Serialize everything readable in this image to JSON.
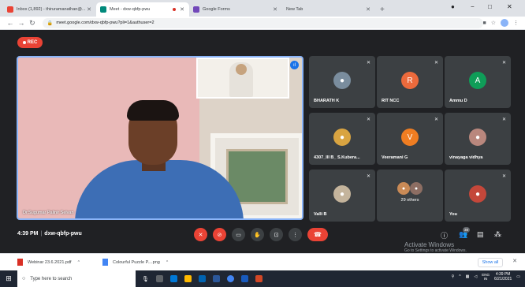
{
  "browser": {
    "tabs": [
      {
        "title": "Inbox (1,892) - thiruramanathan@...",
        "color": "#ea4335"
      },
      {
        "title": "Meet - dxw-qbfp-pwu",
        "color": "#00897b"
      },
      {
        "title": "Google Forms",
        "color": "#7248b9"
      },
      {
        "title": "New Tab",
        "color": "#dee1e6"
      }
    ],
    "url": "meet.google.com/dxw-qbfp-pwu?pli=1&authuser=2"
  },
  "meet": {
    "rec_label": "REC",
    "main_video_name": "Dr.Sugumar Palinir Selvan",
    "meeting_time": "4:39 PM",
    "meeting_code": "dxw-qbfp-pwu",
    "participant_badge": "38",
    "participants": [
      {
        "name": "BHARATH K",
        "type": "photo",
        "color": "#7a8d9e"
      },
      {
        "name": "RIT NCC",
        "type": "initial",
        "initial": "R",
        "color": "#ec6a3c"
      },
      {
        "name": "Ammu D",
        "type": "initial",
        "initial": "A",
        "color": "#0f9d58"
      },
      {
        "name": "4307_III B_ S.Kubera...",
        "type": "photo",
        "color": "#d9a441"
      },
      {
        "name": "Veeramani G",
        "type": "initial",
        "initial": "V",
        "color": "#ef7d22"
      },
      {
        "name": "vinayaga vidhya",
        "type": "photo",
        "color": "#b9877d"
      },
      {
        "name": "Valli B",
        "type": "photo",
        "color": "#c4b49c"
      },
      {
        "name": "29 others",
        "type": "others",
        "color": "#c98a56"
      },
      {
        "name": "You",
        "type": "photo",
        "color": "#c4473a"
      }
    ]
  },
  "watermark": {
    "line1": "Activate Windows",
    "line2": "Go to Settings to activate Windows."
  },
  "downloads": {
    "items": [
      "Webinar 23.6.2021.pdf",
      "Colourful Puzzle P....png"
    ],
    "show_all": "Show all"
  },
  "taskbar": {
    "search_placeholder": "Type here to search",
    "lang": "ENG",
    "lang_region": "IN",
    "time": "4:39 PM",
    "date": "6/21/2021"
  }
}
